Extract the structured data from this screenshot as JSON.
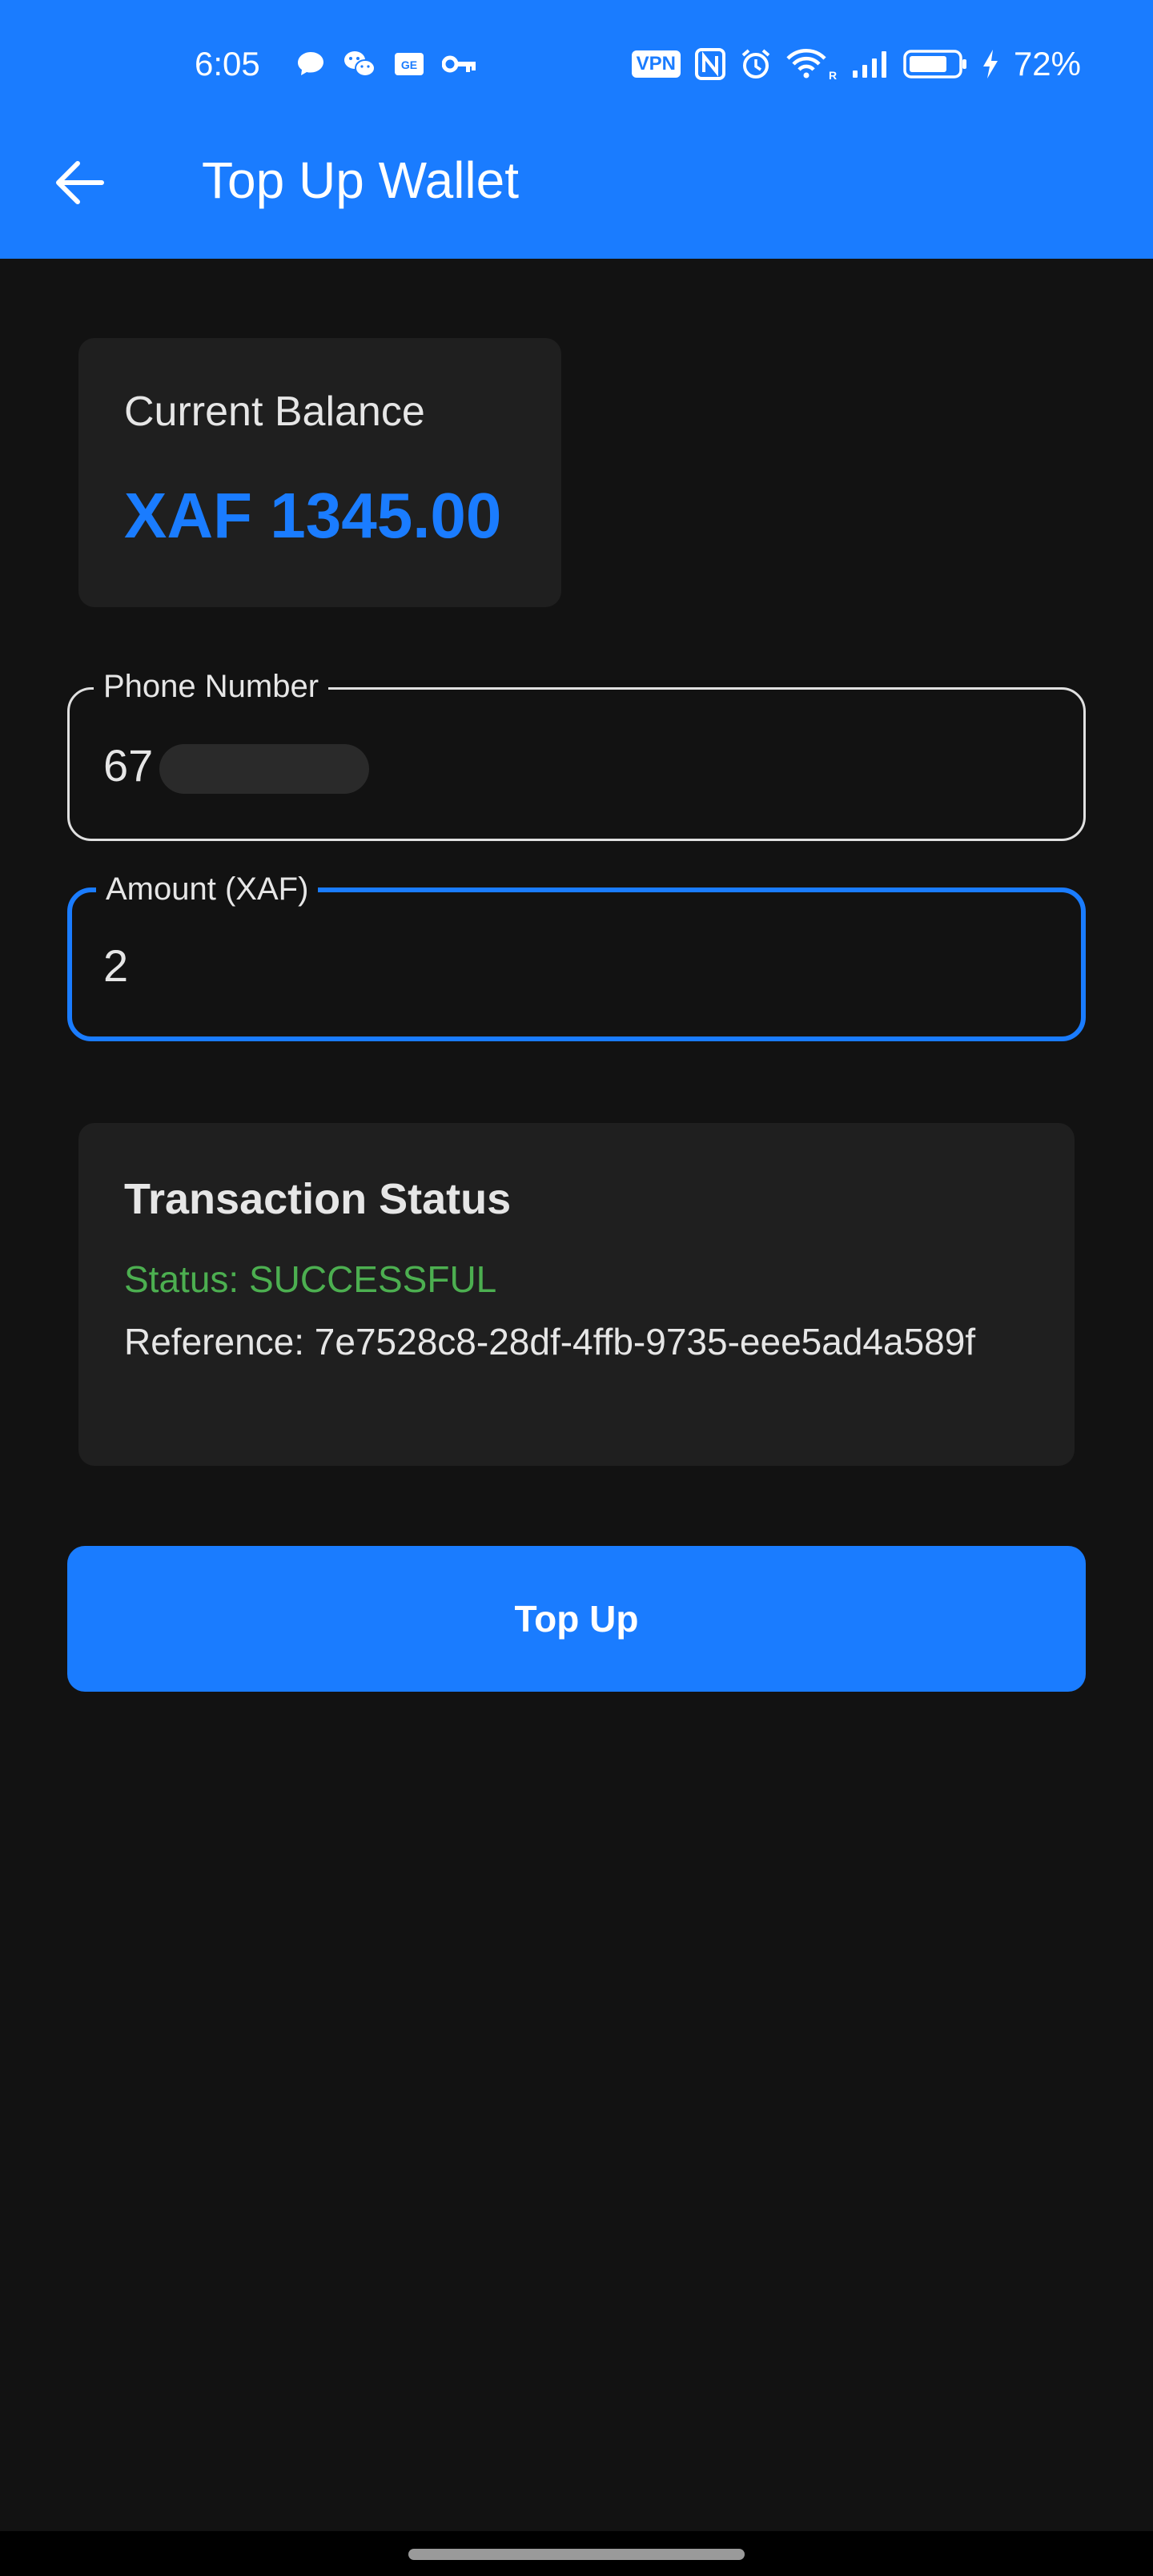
{
  "status_bar": {
    "time": "6:05",
    "vpn": "VPN",
    "battery_percent": "72%",
    "notification_icons": [
      "chat-bubble-icon",
      "wechat-icon",
      "gallery-icon",
      "key-icon"
    ],
    "system_icons": [
      "vpn-icon",
      "nfc-icon",
      "alarm-icon",
      "wifi-icon",
      "signal-icon",
      "battery-icon",
      "charging-icon"
    ]
  },
  "app_bar": {
    "title": "Top Up Wallet",
    "back_icon": "arrow-left-icon"
  },
  "balance": {
    "label": "Current Balance",
    "value": "XAF 1345.00"
  },
  "form": {
    "phone": {
      "label": "Phone Number",
      "value": "67"
    },
    "amount": {
      "label": "Amount (XAF)",
      "value": "2"
    }
  },
  "transaction": {
    "title": "Transaction Status",
    "status": "Status: SUCCESSFUL",
    "reference": "Reference: 7e7528c8-28df-4ffb-9735-eee5ad4a589f"
  },
  "actions": {
    "topup_label": "Top Up"
  },
  "colors": {
    "primary": "#1a7cff",
    "background": "#121212",
    "card": "#1f1f1f",
    "success": "#4caf50"
  }
}
